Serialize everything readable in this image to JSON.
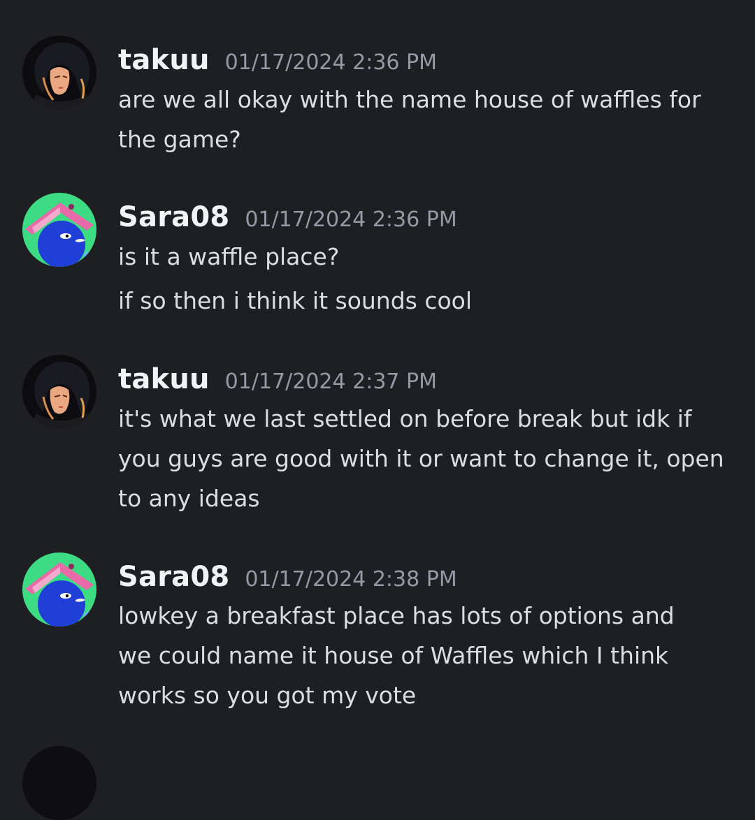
{
  "messages": [
    {
      "author": "takuu",
      "timestamp": "01/17/2024 2:36 PM",
      "avatar_icon": "anime-character-avatar",
      "lines": [
        "are we all okay with the name house of waffles for",
        "the game?"
      ]
    },
    {
      "author": "Sara08",
      "timestamp": "01/17/2024 2:36 PM",
      "avatar_icon": "blue-penguin-book-avatar",
      "lines": [
        "is it a waffle place?"
      ],
      "lines2": [
        "if so then i think it sounds cool"
      ]
    },
    {
      "author": "takuu",
      "timestamp": "01/17/2024 2:37 PM",
      "avatar_icon": "anime-character-avatar",
      "lines": [
        "it's what we last settled on before break but idk if",
        "you guys are good with it or want to change it, open",
        "to any ideas"
      ]
    },
    {
      "author": "Sara08",
      "timestamp": "01/17/2024 2:38 PM",
      "avatar_icon": "blue-penguin-book-avatar",
      "lines": [
        "lowkey a breakfast place has lots of options and",
        "we could name it house of Waffles which I think",
        "works so you got my vote"
      ]
    }
  ],
  "colors": {
    "background": "#1e1f22",
    "username": "#f2f3f5",
    "timestamp": "#949ba4",
    "message_text": "#dbdee1",
    "avatar_green": "#3ddc84",
    "penguin_blue": "#1f3fd6",
    "book_pink": "#e86aa8"
  }
}
